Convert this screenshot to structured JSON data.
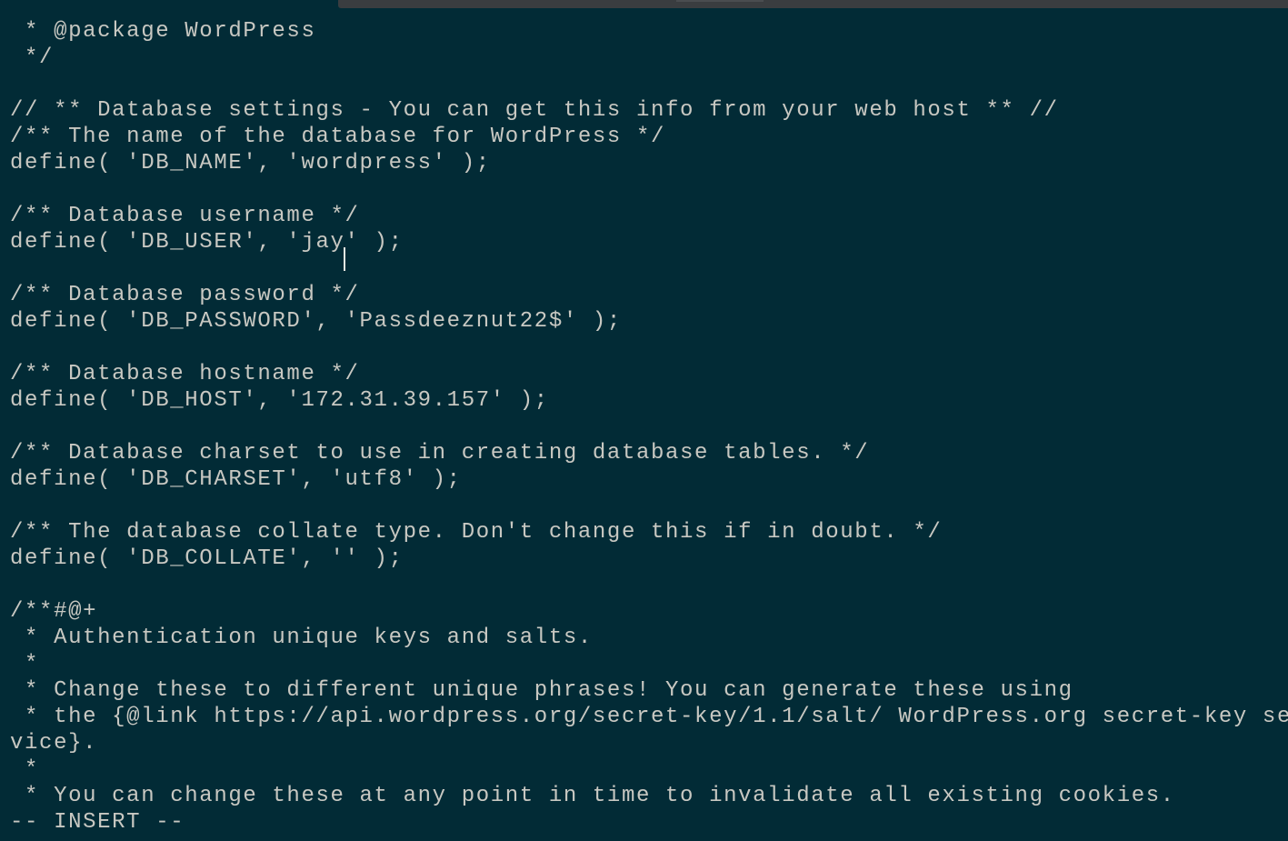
{
  "editor": {
    "mode": "insert",
    "status_line": "-- INSERT --",
    "lines": [
      " * @package WordPress",
      " */",
      "",
      "// ** Database settings - You can get this info from your web host ** //",
      "/** The name of the database for WordPress */",
      "define( 'DB_NAME', 'wordpress' );",
      "",
      "/** Database username */",
      "define( 'DB_USER', 'jay' );",
      "",
      "/** Database password */",
      "define( 'DB_PASSWORD', 'Passdeeznut22$' );",
      "",
      "/** Database hostname */",
      "define( 'DB_HOST', '172.31.39.157' );",
      "",
      "/** Database charset to use in creating database tables. */",
      "define( 'DB_CHARSET', 'utf8' );",
      "",
      "/** The database collate type. Don't change this if in doubt. */",
      "define( 'DB_COLLATE', '' );",
      "",
      "/**#@+",
      " * Authentication unique keys and salts.",
      " *",
      " * Change these to different unique phrases! You can generate these using",
      " * the {@link https://api.wordpress.org/secret-key/1.1/salt/ WordPress.org secret-key se",
      "vice}.",
      " *",
      " * You can change these at any point in time to invalidate all existing cookies."
    ]
  }
}
